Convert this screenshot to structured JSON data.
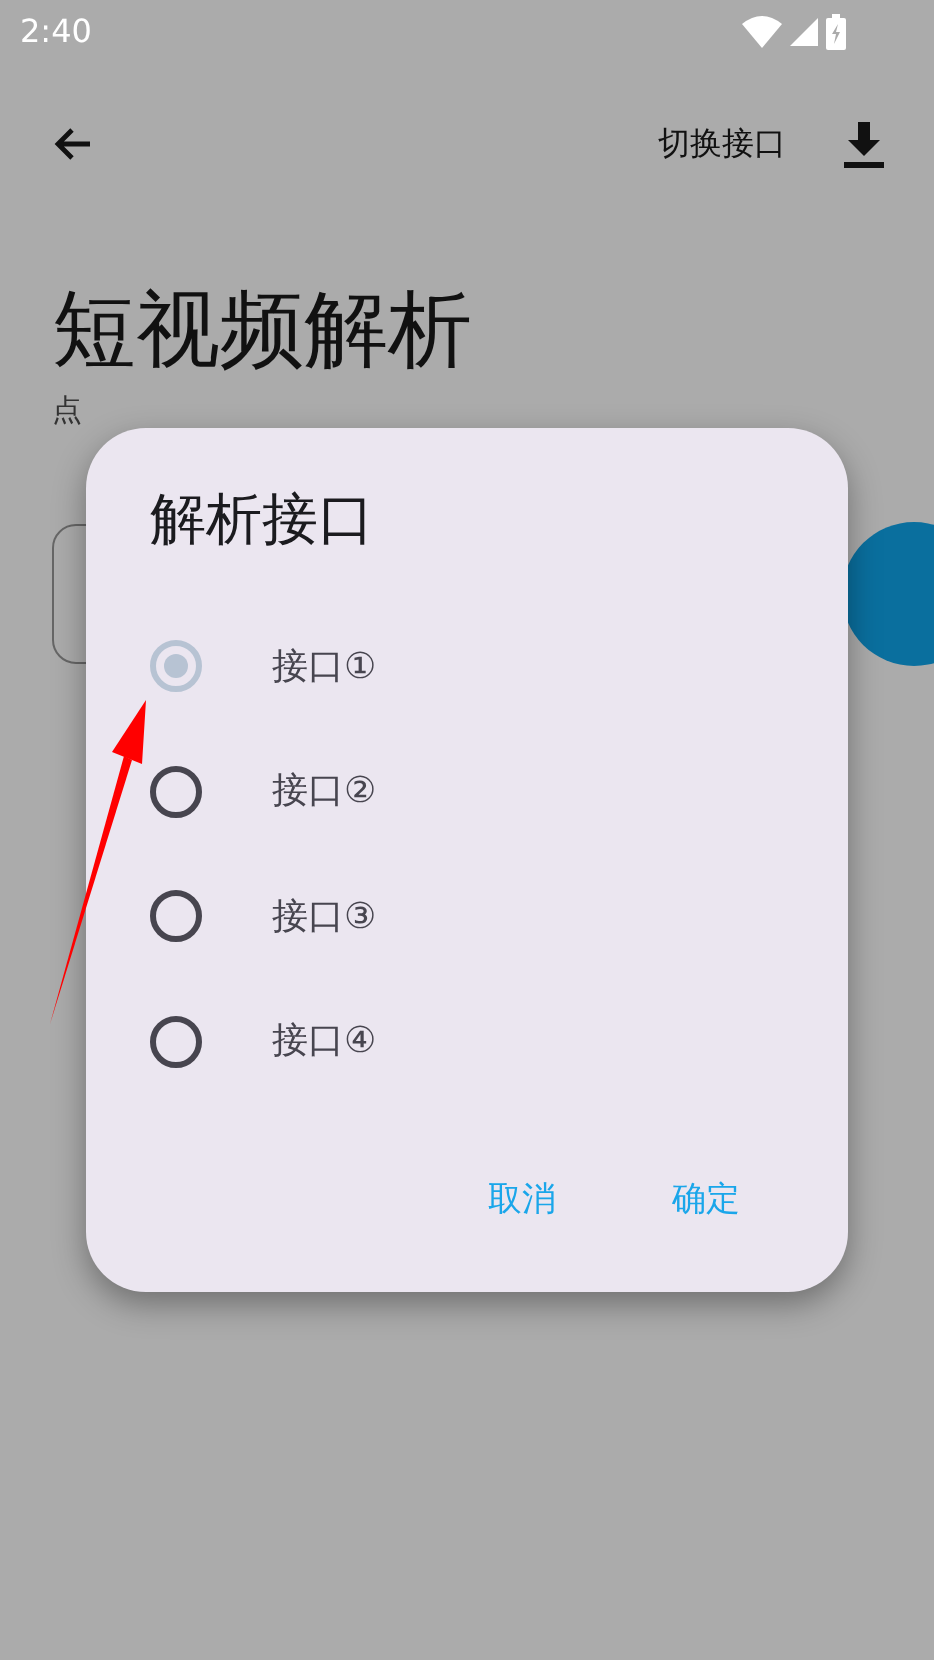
{
  "status_bar": {
    "time": "2:40"
  },
  "toolbar": {
    "action": "切换接口"
  },
  "page": {
    "title": "短视频解析",
    "subtitle": "点"
  },
  "dialog": {
    "title": "解析接口",
    "options": [
      {
        "label": "接口①",
        "selected": true
      },
      {
        "label": "接口②",
        "selected": false
      },
      {
        "label": "接口③",
        "selected": false
      },
      {
        "label": "接口④",
        "selected": false
      }
    ],
    "buttons": [
      "取消",
      "确定"
    ]
  }
}
